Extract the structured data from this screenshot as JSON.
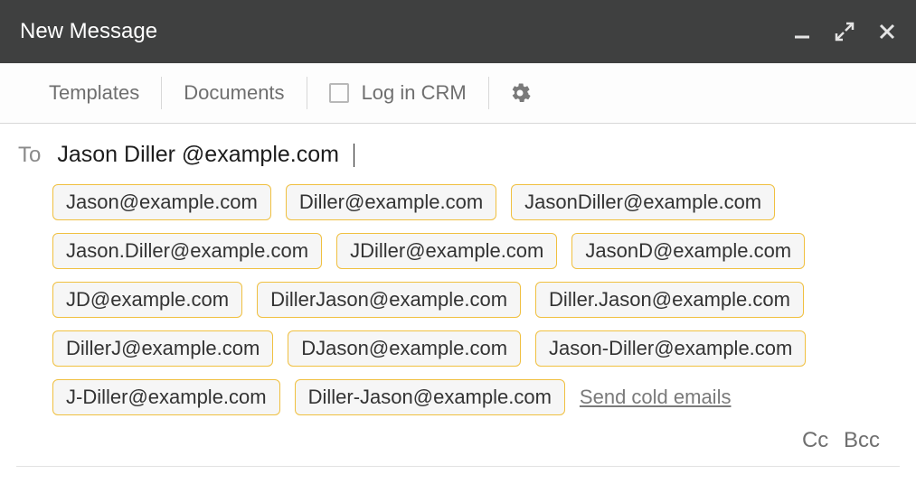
{
  "header": {
    "title": "New Message"
  },
  "toolbar": {
    "templates_label": "Templates",
    "documents_label": "Documents",
    "log_in_crm_label": "Log in CRM"
  },
  "compose": {
    "to_label": "To",
    "to_value": "Jason Diller @example.com",
    "cc_label": "Cc",
    "bcc_label": "Bcc"
  },
  "suggestions": [
    "Jason@example.com",
    "Diller@example.com",
    "JasonDiller@example.com",
    "Jason.Diller@example.com",
    "JDiller@example.com",
    "JasonD@example.com",
    "JD@example.com",
    "DillerJason@example.com",
    "Diller.Jason@example.com",
    "DillerJ@example.com",
    "DJason@example.com",
    "Jason-Diller@example.com",
    "J-Diller@example.com",
    "Diller-Jason@example.com"
  ],
  "links": {
    "send_cold_emails": "Send cold emails"
  }
}
